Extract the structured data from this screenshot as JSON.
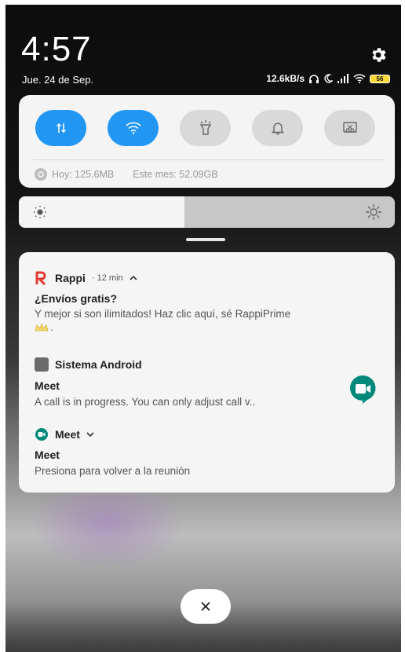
{
  "status_bar": {
    "time": "4:57",
    "date": "Jue. 24 de Sep.",
    "net_speed": "12.6kB/s",
    "battery": "56"
  },
  "quick_settings": {
    "tiles": [
      {
        "icon": "data-transfer-icon",
        "active": true
      },
      {
        "icon": "wifi-icon",
        "active": true
      },
      {
        "icon": "flashlight-icon",
        "active": false
      },
      {
        "icon": "bell-icon",
        "active": false
      },
      {
        "icon": "screenshot-icon",
        "active": false
      }
    ],
    "usage_today": "Hoy: 125.6MB",
    "usage_month": "Este mes: 52.09GB",
    "brightness_fraction": 0.44,
    "accent": "#2196f3"
  },
  "notifications": [
    {
      "app": "Rappi",
      "time": "· 12 min",
      "title": "¿Envíos gratis?",
      "body_line1": "Y mejor si son ilimitados! Haz clic aquí, sé RappiPrime",
      "body_line2": "."
    },
    {
      "app": "Sistema Android",
      "title": "Meet",
      "body": "A call is in progress. You can only adjust call v.."
    },
    {
      "app": "Meet",
      "title": "Meet",
      "body": "Presiona para volver a la reunión"
    }
  ]
}
